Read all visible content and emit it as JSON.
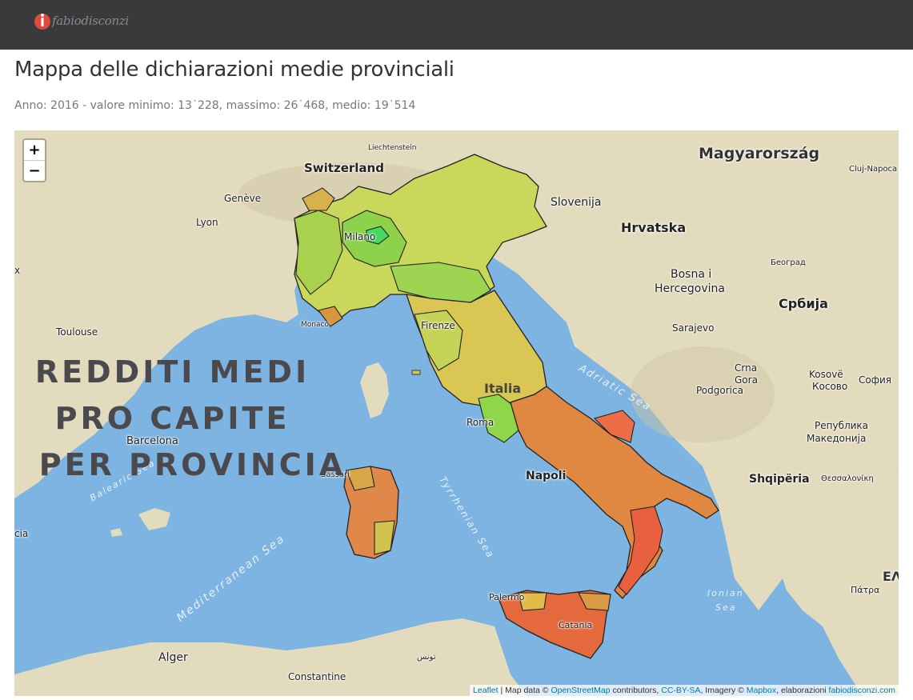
{
  "header": {
    "logo_text": "fabiodisconzi"
  },
  "page": {
    "title": "Mappa delle dichiarazioni medie provinciali",
    "subtitle": "Anno: 2016 - valore minimo: 13˙228, massimo: 26˙468, medio: 19˙514"
  },
  "zoom": {
    "in_label": "+",
    "out_label": "−"
  },
  "map_labels": {
    "magyarorszag": "Magyarország",
    "switzerland": "Switzerland",
    "liechtenstein": "Liechtenstein",
    "cluj": "Cluj-Napoca",
    "geneve": "Genève",
    "slovenija": "Slovenija",
    "lyon": "Lyon",
    "hrvatska": "Hrvatska",
    "milano": "Milano",
    "beograd": "Београд",
    "bosna1": "Bosna i",
    "bosna2": "Hercegovina",
    "srbija": "Србија",
    "sarajevo": "Sarajevo",
    "toulouse": "Toulouse",
    "monaco": "Monaco",
    "firenze": "Firenze",
    "crna1": "Crna",
    "crna2": "Gora",
    "kosove1": "Kosovë",
    "kosove2": "Косово",
    "sofia": "София",
    "podgorica": "Podgorica",
    "italia": "Italia",
    "roma": "Roma",
    "republika1": "Република",
    "republika2": "Македонија",
    "barcelona": "Barcelona",
    "napoli": "Napoli",
    "shqiperia": "Shqipëria",
    "thessaloniki": "Θεσσαλονίκη",
    "sassari": "Sassari",
    "palermo": "Palermo",
    "catania": "Catania",
    "patra": "Πάτρα",
    "ell": "ΕΛ",
    "alger": "Alger",
    "tunis": "تونس",
    "constantine": "Constantine",
    "x_left": "x",
    "cia_left": "cia"
  },
  "sea_labels": {
    "adriatic": "Adriatic Sea",
    "tyrrhenian": "Tyrrhenian Sea",
    "balearic": "Balearic Sea",
    "mediterranean": "Mediterranean Sea",
    "ionian1": "Ionian",
    "ionian2": "Sea"
  },
  "overlay": {
    "line1": "REDDITI MEDI",
    "line2": "PRO CAPITE",
    "line3": "PER PROVINCIA"
  },
  "attribution": {
    "leaflet": "Leaflet",
    "sep1": " | Map data © ",
    "osm": "OpenStreetMap",
    "sep2": " contributors, ",
    "ccbysa": "CC-BY-SA",
    "sep3": ", Imagery © ",
    "mapbox": "Mapbox",
    "sep4": ", elaborazioni ",
    "site": "fabiodisconzi.com"
  },
  "colors": {
    "sea": "#7eb4e1",
    "land": "#e8dfc4",
    "high_income": "#7fd64a",
    "mid_income": "#e0d050",
    "low_income": "#e86a3e"
  }
}
